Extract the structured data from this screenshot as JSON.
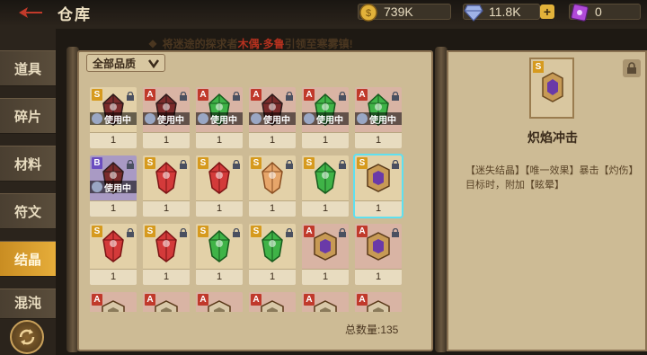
{
  "header": {
    "title": "仓库"
  },
  "resources": [
    {
      "name": "gold",
      "value": "739K",
      "color": "#e2b23a"
    },
    {
      "name": "gem",
      "value": "11.8K",
      "color": "#a7b8e8"
    },
    {
      "name": "ticket",
      "value": "0",
      "color": "#b04ad8"
    }
  ],
  "tabs": [
    {
      "label": "道具",
      "active": false
    },
    {
      "label": "碎片",
      "active": false
    },
    {
      "label": "材料",
      "active": false
    },
    {
      "label": "符文",
      "active": false
    },
    {
      "label": "结晶",
      "active": true
    },
    {
      "label": "混沌",
      "active": false
    }
  ],
  "notice": {
    "prefix": "将迷途的探求者",
    "highlight": "木偶·多鲁",
    "suffix": "引领至寒雾镇!"
  },
  "filter": {
    "label": "全部品质"
  },
  "items": [
    {
      "rarity": "S",
      "gem": "dark",
      "locked": true,
      "in_use": "使用中",
      "count": "1"
    },
    {
      "rarity": "A",
      "gem": "dark",
      "locked": true,
      "in_use": "使用中",
      "count": "1"
    },
    {
      "rarity": "A",
      "gem": "green",
      "locked": true,
      "in_use": "使用中",
      "count": "1"
    },
    {
      "rarity": "A",
      "gem": "dark",
      "locked": true,
      "in_use": "使用中",
      "count": "1"
    },
    {
      "rarity": "A",
      "gem": "green",
      "locked": true,
      "in_use": "使用中",
      "count": "1"
    },
    {
      "rarity": "A",
      "gem": "green",
      "locked": true,
      "in_use": "使用中",
      "count": "1"
    },
    {
      "rarity": "B",
      "gem": "dark",
      "locked": true,
      "in_use": "使用中",
      "count": "1"
    },
    {
      "rarity": "S",
      "gem": "red",
      "locked": true,
      "in_use": "",
      "count": "1"
    },
    {
      "rarity": "S",
      "gem": "red",
      "locked": true,
      "in_use": "",
      "count": "1"
    },
    {
      "rarity": "S",
      "gem": "amber",
      "locked": true,
      "in_use": "",
      "count": "1"
    },
    {
      "rarity": "S",
      "gem": "green",
      "locked": true,
      "in_use": "",
      "count": "1"
    },
    {
      "rarity": "S",
      "gem": "frame",
      "locked": true,
      "in_use": "",
      "count": "1",
      "selected": true
    },
    {
      "rarity": "S",
      "gem": "red",
      "locked": true,
      "in_use": "",
      "count": "1"
    },
    {
      "rarity": "S",
      "gem": "red",
      "locked": true,
      "in_use": "",
      "count": "1"
    },
    {
      "rarity": "S",
      "gem": "green",
      "locked": true,
      "in_use": "",
      "count": "1"
    },
    {
      "rarity": "S",
      "gem": "green",
      "locked": true,
      "in_use": "",
      "count": "1"
    },
    {
      "rarity": "A",
      "gem": "frame",
      "locked": true,
      "in_use": "",
      "count": "1"
    },
    {
      "rarity": "A",
      "gem": "frame",
      "locked": true,
      "in_use": "",
      "count": "1"
    },
    {
      "rarity": "A",
      "gem": "partial",
      "locked": false,
      "in_use": "",
      "count": ""
    },
    {
      "rarity": "A",
      "gem": "partial",
      "locked": false,
      "in_use": "",
      "count": ""
    },
    {
      "rarity": "A",
      "gem": "partial",
      "locked": false,
      "in_use": "",
      "count": ""
    },
    {
      "rarity": "A",
      "gem": "partial",
      "locked": false,
      "in_use": "",
      "count": ""
    },
    {
      "rarity": "A",
      "gem": "partial",
      "locked": false,
      "in_use": "",
      "count": ""
    },
    {
      "rarity": "A",
      "gem": "partial",
      "locked": false,
      "in_use": "",
      "count": ""
    }
  ],
  "total": "总数量:135",
  "detail": {
    "rarity": "S",
    "name": "炽焰冲击",
    "description": "【迷失结晶】【唯一效果】暴击【灼伤】目标时，附加【眩晕】"
  },
  "colors": {
    "rarity_S": "#d69a1e",
    "rarity_A": "#c0392b",
    "rarity_B": "#6b4ec0",
    "selected_outline": "#5fe0f0",
    "active_tab": "#e6ad3a"
  }
}
